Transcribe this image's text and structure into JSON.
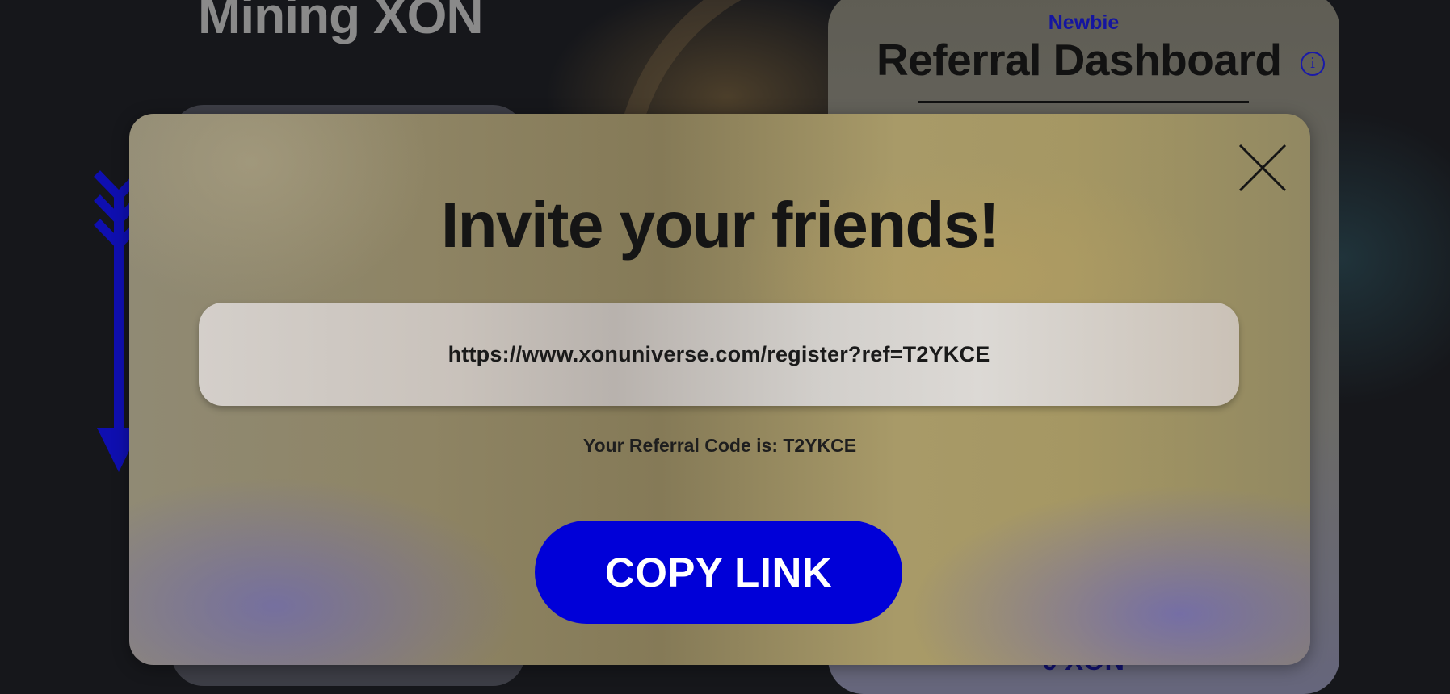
{
  "background": {
    "page_title": "Mining XON",
    "dashboard": {
      "rank": "Newbie",
      "title": "Referral Dashboard",
      "info_icon": "info-icon",
      "balance_partial": "0 XON"
    },
    "accent_color": "#0000d8"
  },
  "modal": {
    "title": "Invite your friends!",
    "close_icon": "close-icon",
    "referral_link": "https://www.xonuniverse.com/register?ref=T2YKCE",
    "referral_code_text": "Your Referral Code is: T2YKCE",
    "copy_button_label": "COPY LINK"
  }
}
